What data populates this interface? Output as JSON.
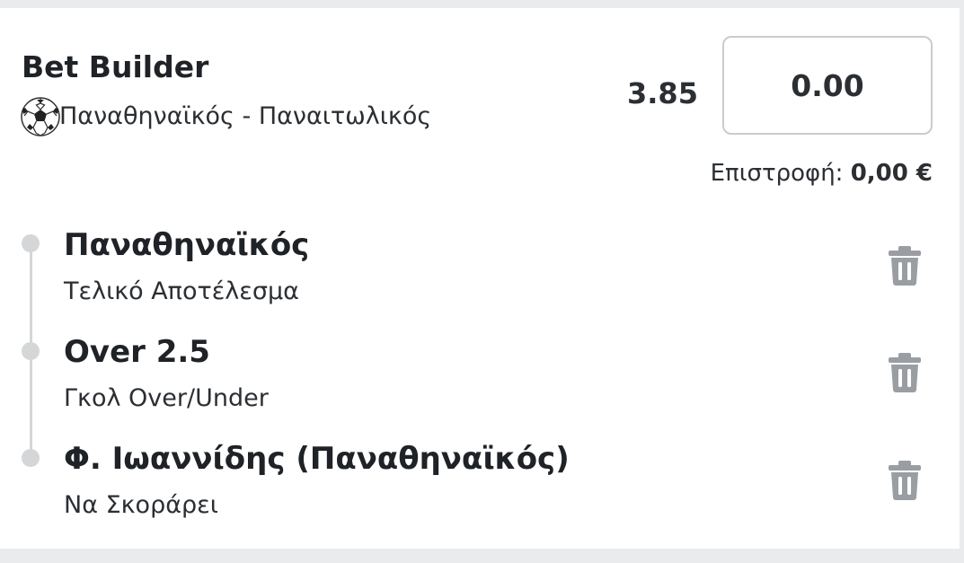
{
  "bet": {
    "title": "Bet Builder",
    "sport_icon": "soccer-ball-icon",
    "match": "Παναθηναϊκός - Παναιτωλικός",
    "odds": "3.85",
    "stake_value": "0.00",
    "returns_label": "Επιστροφή:",
    "returns_value": "0,00 €"
  },
  "selections": [
    {
      "name": "Παναθηναϊκός",
      "market": "Τελικό Αποτέλεσμα",
      "icon": "trash-icon"
    },
    {
      "name": "Over 2.5",
      "market": "Γκολ Over/Under",
      "icon": "trash-icon"
    },
    {
      "name": "Φ. Ιωαννίδης (Παναθηναϊκός)",
      "market": "Να Σκοράρει",
      "icon": "trash-icon"
    }
  ],
  "colors": {
    "page_background": "#e9ebec",
    "card_background": "#ffffff",
    "text_primary": "#1f2226",
    "timeline": "#d4d6d8",
    "trash_icon": "#9a9ea2",
    "input_border": "#c9cccf"
  }
}
